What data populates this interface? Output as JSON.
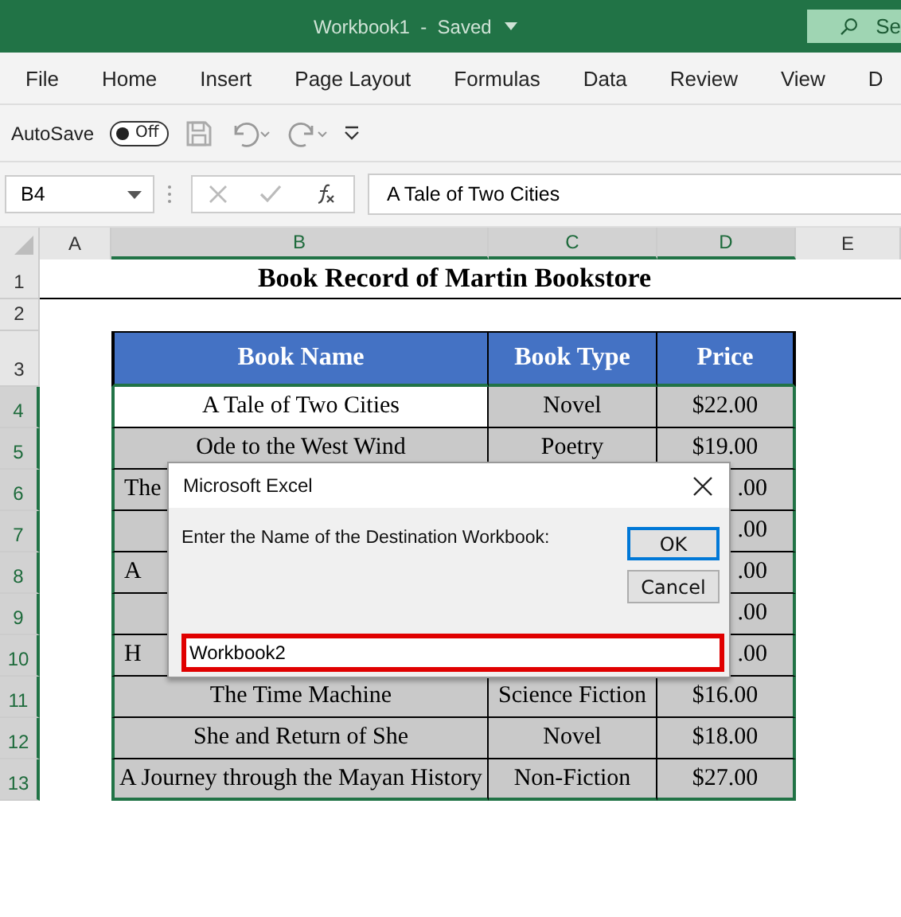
{
  "title_bar": {
    "title": "Workbook1  -  Saved",
    "search_text": "Se"
  },
  "menu": [
    {
      "label": "File"
    },
    {
      "label": "Home"
    },
    {
      "label": "Insert"
    },
    {
      "label": "Page Layout"
    },
    {
      "label": "Formulas"
    },
    {
      "label": "Data"
    },
    {
      "label": "Review"
    },
    {
      "label": "View"
    },
    {
      "label": "D"
    }
  ],
  "quick_access": {
    "autosave_label": "AutoSave",
    "toggle": {
      "label": "Off",
      "on": false
    }
  },
  "formula_bar": {
    "name_box": "B4",
    "formula": "A Tale of Two Cities"
  },
  "columns": [
    {
      "label": "A",
      "selected": false
    },
    {
      "label": "B",
      "selected": true
    },
    {
      "label": "C",
      "selected": true
    },
    {
      "label": "D",
      "selected": true
    },
    {
      "label": "E",
      "selected": false
    }
  ],
  "rows": [
    {
      "header": "1",
      "selected": false,
      "kind": "title",
      "text": "Book Record of Martin Bookstore"
    },
    {
      "header": "2",
      "selected": false,
      "kind": "blank"
    },
    {
      "header": "3",
      "selected": false,
      "kind": "table_header",
      "cells": [
        {
          "text": "Book Name"
        },
        {
          "text": "Book Type"
        },
        {
          "text": "Price"
        }
      ]
    },
    {
      "header": "4",
      "selected": true,
      "kind": "data",
      "cells": [
        {
          "text": "A Tale of Two Cities",
          "active": true
        },
        {
          "text": "Novel",
          "active": false
        },
        {
          "text": "$22.00",
          "active": false
        }
      ]
    },
    {
      "header": "5",
      "selected": true,
      "kind": "data",
      "cells": [
        {
          "text": "Ode to the West Wind",
          "active": false
        },
        {
          "text": "Poetry",
          "active": false
        },
        {
          "text": "$19.00",
          "active": false
        }
      ]
    },
    {
      "header": "6",
      "selected": true,
      "kind": "data",
      "cells": [
        {
          "text": "The",
          "active": false,
          "partial": true
        },
        null,
        {
          "text": ".00",
          "active": false,
          "partial": true
        }
      ]
    },
    {
      "header": "7",
      "selected": true,
      "kind": "data",
      "cells": [
        {
          "active": false
        },
        null,
        {
          "text": ".00",
          "active": false,
          "partial": true
        }
      ]
    },
    {
      "header": "8",
      "selected": true,
      "kind": "data",
      "cells": [
        {
          "text": "A",
          "active": false,
          "partial": true
        },
        null,
        {
          "text": ".00",
          "active": false,
          "partial": true
        }
      ]
    },
    {
      "header": "9",
      "selected": true,
      "kind": "data",
      "cells": [
        {
          "active": false
        },
        null,
        {
          "text": ".00",
          "active": false,
          "partial": true
        }
      ]
    },
    {
      "header": "10",
      "selected": true,
      "kind": "data",
      "cells": [
        {
          "text": "H",
          "active": false,
          "partial": true
        },
        null,
        {
          "text": ".00",
          "active": false,
          "partial": true
        }
      ]
    },
    {
      "header": "11",
      "selected": true,
      "kind": "data",
      "cells": [
        {
          "text": "The Time Machine",
          "active": false
        },
        {
          "text": "Science Fiction",
          "active": false
        },
        {
          "text": "$16.00",
          "active": false
        }
      ]
    },
    {
      "header": "12",
      "selected": true,
      "kind": "data",
      "cells": [
        {
          "text": "She and Return of She",
          "active": false
        },
        {
          "text": "Novel",
          "active": false
        },
        {
          "text": "$18.00",
          "active": false
        }
      ]
    },
    {
      "header": "13",
      "selected": true,
      "kind": "data",
      "cells": [
        {
          "text": "A Journey through the Mayan History",
          "active": false
        },
        {
          "text": "Non-Fiction",
          "active": false
        },
        {
          "text": "$27.00",
          "active": false
        }
      ]
    }
  ],
  "dialog": {
    "title": "Microsoft Excel",
    "prompt": "Enter the Name of the Destination Workbook:",
    "buttons": [
      {
        "label": "OK",
        "default": true
      },
      {
        "label": "Cancel",
        "default": false
      }
    ],
    "input": {
      "value": "Workbook2",
      "highlighted": true
    }
  }
}
